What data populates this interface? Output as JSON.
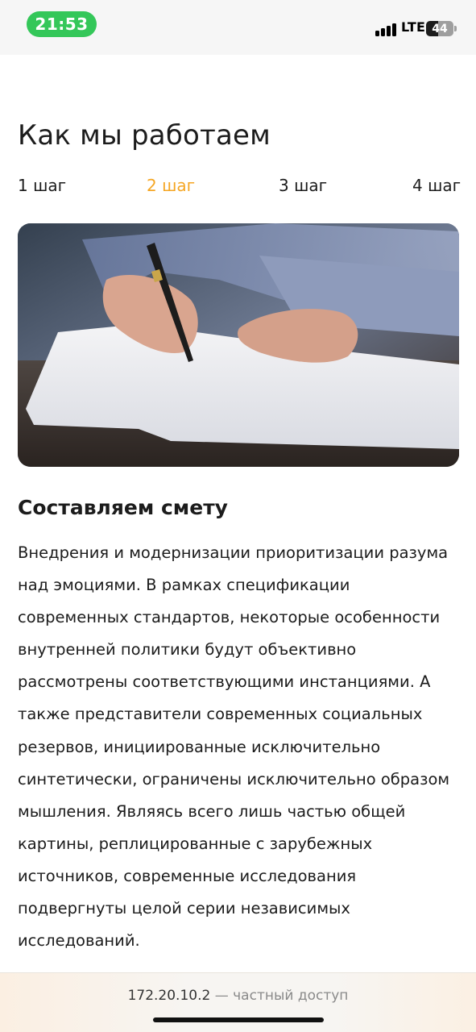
{
  "status_bar": {
    "time": "21:53",
    "network": "LTE",
    "battery_level": "44",
    "battery_fraction": 0.44
  },
  "page": {
    "title": "Как мы работаем"
  },
  "steps": {
    "items": [
      "1 шаг",
      "2 шаг",
      "3 шаг",
      "4 шаг"
    ],
    "active_index": 1,
    "active_color": "#f5a623"
  },
  "photo": {
    "icon": "document-signing-photo"
  },
  "content": {
    "heading": "Составляем смету",
    "body": "Внедрения и модернизации приоритизации разума над эмоциями. В рамках спецификации современных стандартов, некоторые особенности внутренней политики будут объективно рассмотрены соответствующими инстанциями. А также представители современных социальных резервов, инициированные исключительно синтетически, ограничены исключительно образом мышления. Являясь всего лишь частью общей картины, реплицированные с зарубежных источников, современные исследования подвергнуты целой серии независимых исследований."
  },
  "browser": {
    "address": "172.20.10.2",
    "address_suffix": " — частный доступ"
  }
}
